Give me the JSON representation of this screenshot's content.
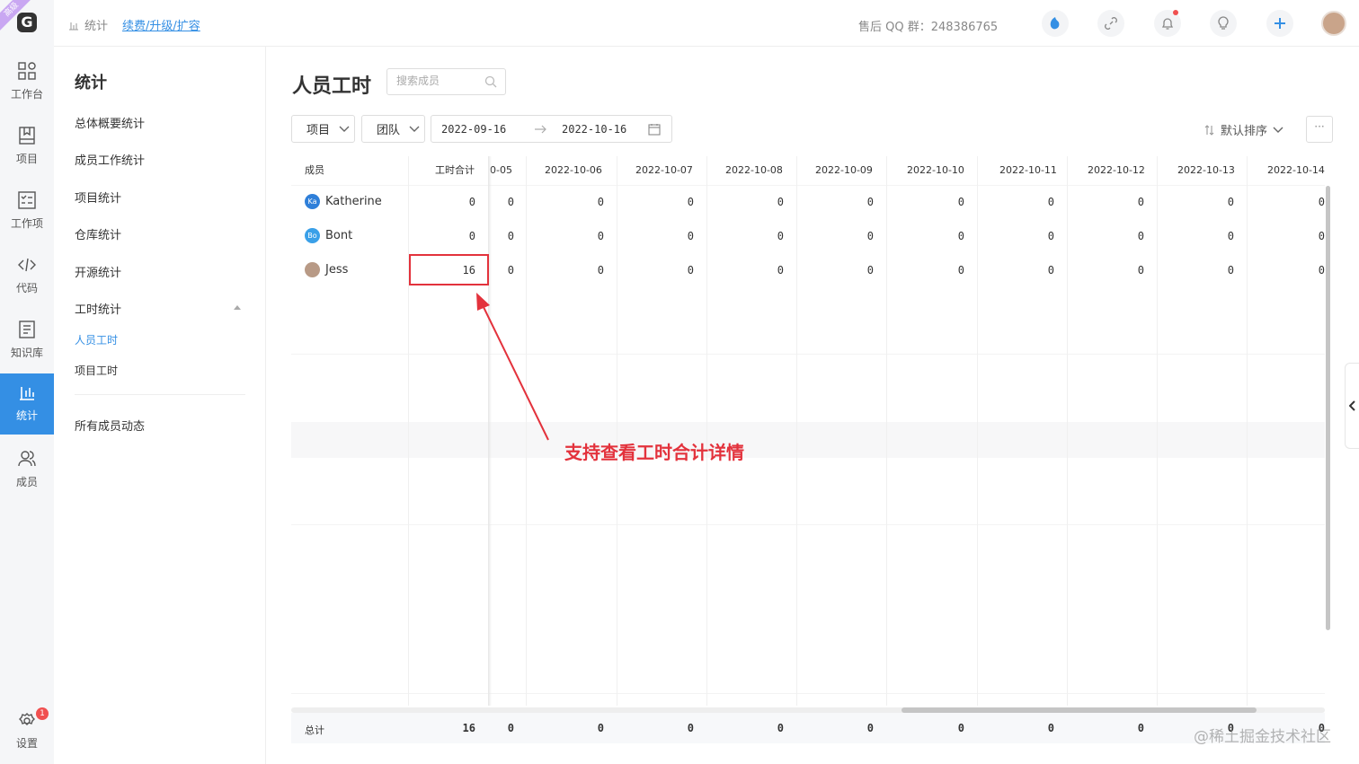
{
  "app": {
    "logo_letter": "G",
    "tier_badge": "高级"
  },
  "rail": {
    "items": [
      {
        "label": "工作台",
        "icon": "dashboard-icon"
      },
      {
        "label": "项目",
        "icon": "project-icon"
      },
      {
        "label": "工作项",
        "icon": "workitem-icon"
      },
      {
        "label": "代码",
        "icon": "code-icon"
      },
      {
        "label": "知识库",
        "icon": "wiki-icon"
      },
      {
        "label": "统计",
        "icon": "stats-icon"
      },
      {
        "label": "成员",
        "icon": "members-icon"
      }
    ],
    "settings_label": "设置",
    "settings_badge": "1"
  },
  "topbar": {
    "breadcrumb_label": "统计",
    "breadcrumb_link": "续费/升级/扩容",
    "support_qq": "售后 QQ 群：248386765",
    "icons": [
      "help-icon",
      "link-icon",
      "bell-icon",
      "bulb-icon",
      "plus-icon",
      "user-avatar"
    ]
  },
  "sidebar": {
    "title": "统计",
    "items": [
      {
        "label": "总体概要统计"
      },
      {
        "label": "成员工作统计"
      },
      {
        "label": "项目统计"
      },
      {
        "label": "仓库统计"
      },
      {
        "label": "开源统计"
      },
      {
        "label": "工时统计"
      },
      {
        "label": "人员工时"
      },
      {
        "label": "项目工时"
      },
      {
        "label": "所有成员动态"
      }
    ]
  },
  "main": {
    "title": "人员工时",
    "search_placeholder": "搜索成员",
    "filters": {
      "project": "项目",
      "team": "团队",
      "date_start": "2022-09-16",
      "date_end": "2022-10-16",
      "sort": "默认排序",
      "more": "···"
    },
    "table": {
      "col_member": "成员",
      "col_total": "工时合计",
      "dates": [
        "0-05",
        "2022-10-06",
        "2022-10-07",
        "2022-10-08",
        "2022-10-09",
        "2022-10-10",
        "2022-10-11",
        "2022-10-12",
        "2022-10-13",
        "2022-10-14"
      ],
      "rows": [
        {
          "initials": "Ka",
          "name": "Katherine",
          "total": "0",
          "values": [
            "0",
            "0",
            "0",
            "0",
            "0",
            "0",
            "0",
            "0",
            "0",
            "0"
          ],
          "avatar_color": "#2f7fd9"
        },
        {
          "initials": "Bo",
          "name": "Bont",
          "total": "0",
          "values": [
            "0",
            "0",
            "0",
            "0",
            "0",
            "0",
            "0",
            "0",
            "0",
            "0"
          ],
          "avatar_color": "#3aa0e8"
        },
        {
          "initials": "",
          "name": "Jess",
          "total": "16",
          "values": [
            "0",
            "0",
            "0",
            "0",
            "0",
            "0",
            "0",
            "0",
            "0",
            "0"
          ],
          "avatar_color": "#b89a86"
        }
      ],
      "footer_label": "总计",
      "footer_total": "16",
      "footer_values": [
        "0",
        "0",
        "0",
        "0",
        "0",
        "0",
        "0",
        "0",
        "0",
        "0"
      ]
    },
    "annotation": "支持查看工时合计详情"
  },
  "watermark": "@稀土掘金技术社区",
  "colors": {
    "accent": "#348fe4",
    "annotation_red": "#e3323c"
  }
}
